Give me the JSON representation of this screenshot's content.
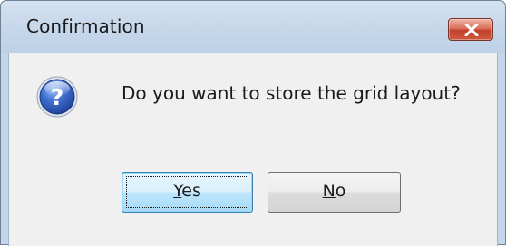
{
  "dialog": {
    "title": "Confirmation",
    "message": "Do you want to store the grid layout?",
    "icon": "question-icon"
  },
  "buttons": {
    "yes": {
      "mnemonic": "Y",
      "rest": "es"
    },
    "no": {
      "mnemonic": "N",
      "rest": "o"
    }
  },
  "colors": {
    "titlebar": "#c4d6ea",
    "close_button": "#c8472f",
    "client_background": "#f0f0f0",
    "default_button_border": "#3c7fb1"
  }
}
